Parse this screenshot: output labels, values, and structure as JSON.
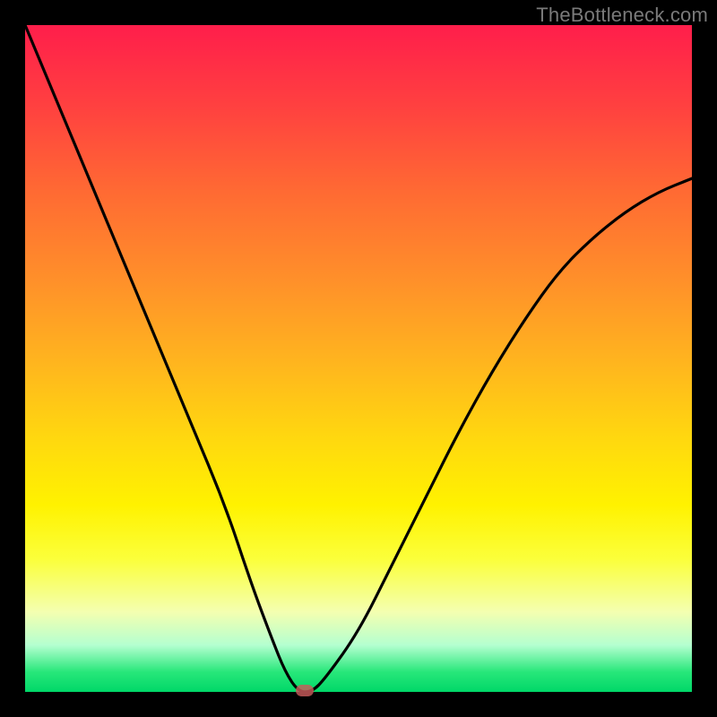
{
  "watermark": "TheBottleneck.com",
  "colors": {
    "frame": "#000000",
    "marker": "#c85a5a",
    "curve": "#000000"
  },
  "chart_data": {
    "type": "line",
    "title": "",
    "xlabel": "",
    "ylabel": "",
    "xlim": [
      0,
      100
    ],
    "ylim": [
      0,
      100
    ],
    "x": [
      0,
      5,
      10,
      15,
      20,
      25,
      30,
      34,
      37,
      39,
      41,
      43,
      45,
      50,
      55,
      60,
      65,
      70,
      75,
      80,
      85,
      90,
      95,
      100
    ],
    "y": [
      100,
      88,
      76,
      64,
      52,
      40,
      28,
      16,
      8,
      3,
      0,
      0,
      2,
      9,
      19,
      29,
      39,
      48,
      56,
      63,
      68,
      72,
      75,
      77
    ],
    "marker": {
      "x": 42,
      "y": 0
    },
    "grid": false,
    "legend": false,
    "background": "rainbow-vertical-gradient (red→yellow→green)"
  }
}
